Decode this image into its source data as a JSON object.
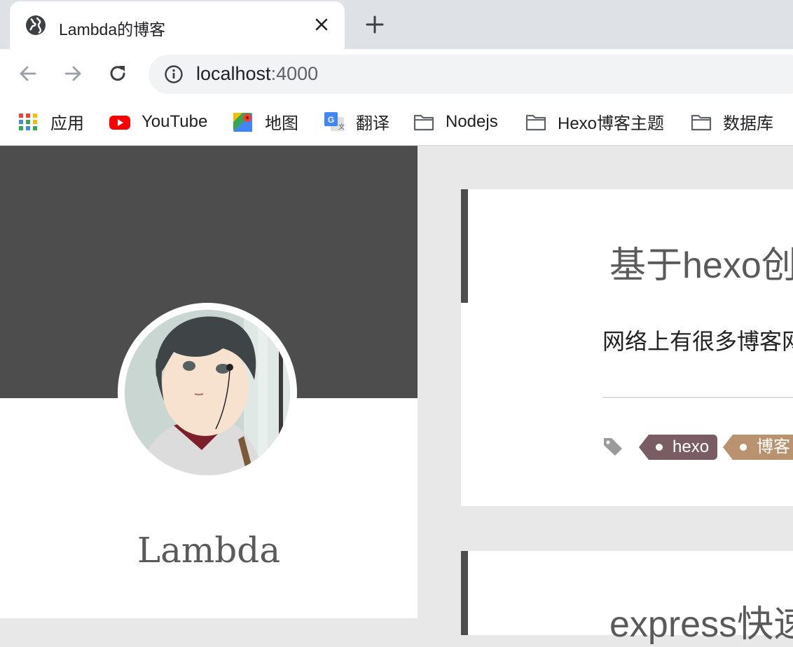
{
  "browser": {
    "tab": {
      "title": "Lambda的博客"
    },
    "address": {
      "host": "localhost",
      "port": ":4000"
    },
    "bookmarks": [
      {
        "label": "应用",
        "icon": "apps-grid-icon"
      },
      {
        "label": "YouTube",
        "icon": "youtube-icon"
      },
      {
        "label": "地图",
        "icon": "maps-icon"
      },
      {
        "label": "翻译",
        "icon": "translate-icon"
      },
      {
        "label": "Nodejs",
        "icon": "folder-icon"
      },
      {
        "label": "Hexo博客主题",
        "icon": "folder-icon"
      },
      {
        "label": "数据库",
        "icon": "folder-icon"
      }
    ]
  },
  "sidebar": {
    "author": "Lambda"
  },
  "posts": [
    {
      "title": "基于hexo创",
      "excerpt": "网络上有很多博客网",
      "tags": [
        {
          "label": "hexo",
          "color": "#7a5c63"
        },
        {
          "label": "博客",
          "color": "#b99270"
        }
      ]
    },
    {
      "title": "express快速"
    }
  ],
  "colors": {
    "banner": "#4d4d4d",
    "page_bg": "#e8e8e8",
    "tab_strip": "#dee1e6"
  }
}
